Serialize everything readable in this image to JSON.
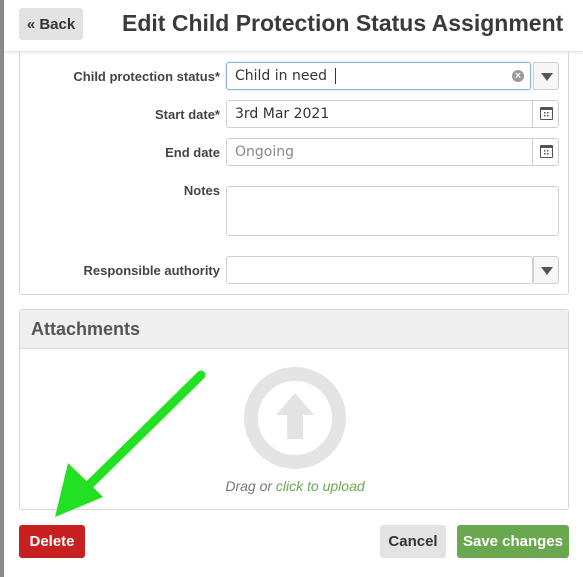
{
  "header": {
    "back_label": "« Back",
    "title": "Edit Child Protection Status Assignment"
  },
  "form": {
    "status_label": "Child protection status*",
    "status_value": "Child in need",
    "start_label": "Start date*",
    "start_value": "3rd Mar 2021",
    "end_label": "End date",
    "end_placeholder": "Ongoing",
    "notes_label": "Notes",
    "notes_value": "",
    "authority_label": "Responsible authority",
    "authority_value": ""
  },
  "attachments": {
    "title": "Attachments",
    "drag_text": "Drag or",
    "upload_link": "click to upload"
  },
  "footer": {
    "delete_label": "Delete",
    "cancel_label": "Cancel",
    "save_label": "Save changes"
  },
  "colors": {
    "delete": "#c82020",
    "save": "#6aa84f",
    "annotation_arrow": "#22e022"
  }
}
